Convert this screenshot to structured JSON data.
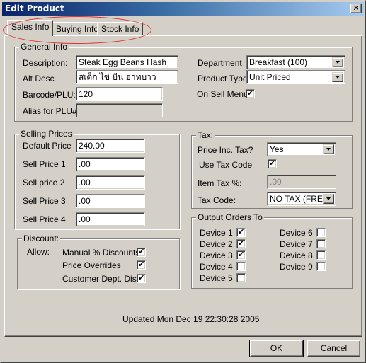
{
  "window": {
    "title": "Edit Product",
    "close_label": "✕"
  },
  "tabs": [
    {
      "label": "Sales Info",
      "active": true
    },
    {
      "label": "Buying Info",
      "active": false
    },
    {
      "label": "Stock Info",
      "active": false
    }
  ],
  "general_info": {
    "title": "General Info",
    "description_label": "Description:",
    "description_value": "Steak Egg Beans Hash",
    "alt_desc_label": "Alt Desc",
    "alt_desc_value": "สเต็ก ไข่ บีน ฮาทบาว",
    "barcode_label": "Barcode/PLU:",
    "barcode_value": "120",
    "alias_label": "Alias for PLU#",
    "alias_value": "",
    "department_label": "Department",
    "department_value": "Breakfast (100)",
    "product_type_label": "Product Type",
    "product_type_value": "Unit Priced",
    "on_sell_menu_label": "On Sell Menu",
    "on_sell_menu_checked": true
  },
  "selling_prices": {
    "title": "Selling Prices",
    "rows": [
      {
        "label": "Default Price",
        "value": "240.00"
      },
      {
        "label": "Sell Price 1",
        "value": ".00"
      },
      {
        "label": "Sell price 2",
        "value": ".00"
      },
      {
        "label": "Sell Price 3",
        "value": ".00"
      },
      {
        "label": "Sell Price 4",
        "value": ".00"
      }
    ]
  },
  "tax": {
    "title": "Tax:",
    "price_inc_tax_label": "Price Inc. Tax?",
    "price_inc_tax_value": "Yes",
    "use_tax_code_label": "Use Tax Code",
    "use_tax_code_checked": true,
    "item_tax_label": "Item Tax %:",
    "item_tax_value": ".00",
    "tax_code_label": "Tax Code:",
    "tax_code_value": "NO TAX (FRE)"
  },
  "discount": {
    "title": "Discount:",
    "allow_label": "Allow:",
    "items": [
      {
        "label": "Manual % Discounts",
        "checked": true
      },
      {
        "label": "Price Overrides",
        "checked": true
      },
      {
        "label": "Customer Dept. Disc.",
        "checked": true
      }
    ]
  },
  "output_orders": {
    "title": "Output Orders To",
    "devices": [
      {
        "label": "Device 1",
        "checked": true
      },
      {
        "label": "Device 2",
        "checked": true
      },
      {
        "label": "Device 3",
        "checked": true
      },
      {
        "label": "Device 4",
        "checked": false
      },
      {
        "label": "Device 5",
        "checked": false
      },
      {
        "label": "Device 6",
        "checked": false
      },
      {
        "label": "Device 7",
        "checked": false
      },
      {
        "label": "Device 8",
        "checked": false
      },
      {
        "label": "Device 9",
        "checked": false
      }
    ]
  },
  "status": {
    "updated_text": "Updated Mon Dec 19 22:30:28 2005"
  },
  "buttons": {
    "ok_label": "OK",
    "cancel_label": "Cancel"
  },
  "colors": {
    "highlight_ellipse": "#e03030",
    "title_bar_start": "#0a246a",
    "title_bar_end": "#a6caf0"
  }
}
